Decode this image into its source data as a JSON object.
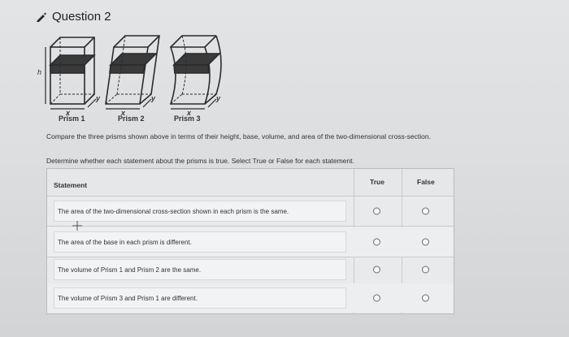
{
  "question": {
    "title": "Question 2",
    "icon": "pencil-icon"
  },
  "figure": {
    "height_label": "h",
    "prisms": [
      {
        "label": "Prism 1",
        "x_label": "x",
        "y_label": "y"
      },
      {
        "label": "Prism 2",
        "x_label": "x",
        "y_label": "y"
      },
      {
        "label": "Prism 3",
        "x_label": "x",
        "y_label": "y"
      }
    ]
  },
  "instructions": {
    "compare": "Compare the three prisms shown above in terms of their height, base, volume, and area of the two-dimensional cross-section.",
    "determine": "Determine whether each statement about the prisms is true. Select True or False for each statement."
  },
  "table": {
    "headers": {
      "statement": "Statement",
      "true": "True",
      "false": "False"
    },
    "rows": [
      {
        "statement": "The area of the two-dimensional cross-section shown in each prism is the same."
      },
      {
        "statement": "The area of the base in each prism is different."
      },
      {
        "statement": "The volume of Prism 1 and Prism 2 are the same."
      },
      {
        "statement": "The volume of Prism 3 and Prism 1 are different."
      }
    ]
  }
}
